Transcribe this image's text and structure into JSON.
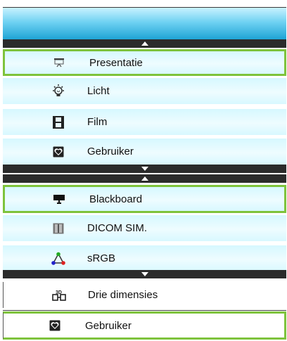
{
  "menu": {
    "group1": [
      "Presentatie",
      "Licht",
      "Film",
      "Gebruiker"
    ],
    "group2": [
      "Blackboard",
      "DICOM SIM.",
      "sRGB"
    ],
    "group3": [
      "Drie dimensies",
      "Gebruiker"
    ]
  },
  "icons": {
    "presentatie": "presentation-icon",
    "licht": "lightbulb-icon",
    "film": "film-strip-icon",
    "gebruiker": "heart-box-icon",
    "blackboard": "blackboard-icon",
    "dicom": "xray-icon",
    "srgb": "color-triangle-icon",
    "drie_dimensies": "3d-icon"
  },
  "colors": {
    "highlight": "#7ec33c",
    "header": "#1ba2d4",
    "item_bg": "#d6f8ff"
  }
}
